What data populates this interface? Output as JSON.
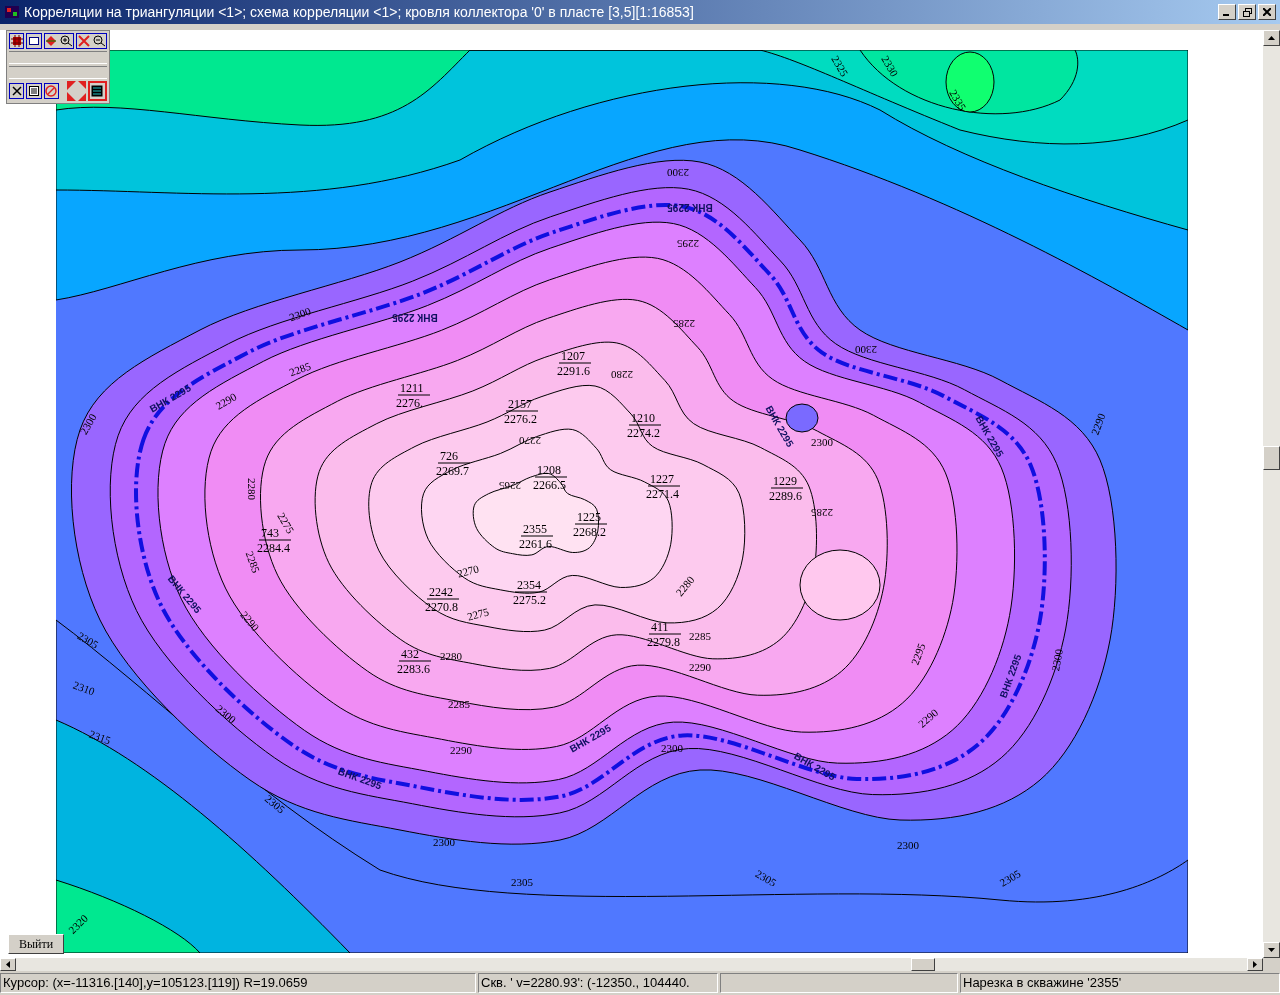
{
  "window": {
    "title": "Корреляции на триангуляции <1>; схема корреляции <1>; кровля коллектора '0' в пласте [3,5][1:16853]"
  },
  "exit_button": {
    "label": "Выйти"
  },
  "map": {
    "wells": [
      {
        "number": "1207",
        "value": "2291.6"
      },
      {
        "number": "1211",
        "value": "2276."
      },
      {
        "number": "2157",
        "value": "2276.2"
      },
      {
        "number": "1210",
        "value": "2274.2"
      },
      {
        "number": "726",
        "value": "2269.7"
      },
      {
        "number": "1208",
        "value": "2266.5"
      },
      {
        "number": "1227",
        "value": "2271.4"
      },
      {
        "number": "1225",
        "value": "2268.2"
      },
      {
        "number": "2355",
        "value": "2261.6"
      },
      {
        "number": "2242",
        "value": "2270.8"
      },
      {
        "number": "2354",
        "value": "2275.2"
      },
      {
        "number": "411",
        "value": "2279.8"
      },
      {
        "number": "432",
        "value": "2283.6"
      },
      {
        "number": "743",
        "value": "2284.4"
      },
      {
        "number": "1229",
        "value": "2289.6"
      }
    ],
    "contour_labels": [
      "2300",
      "2295",
      "2285",
      "2280",
      "2270",
      "2265",
      "2270",
      "2275",
      "2280",
      "2285",
      "2290",
      "2300",
      "2300",
      "2305",
      "2300",
      "2305",
      "2305",
      "2290",
      "2285",
      "2280",
      "2285",
      "2300",
      "2290",
      "2300",
      "2290",
      "2295",
      "2300",
      "2305",
      "2310",
      "2315",
      "2305",
      "2320",
      "2300",
      "2290",
      "2285",
      "2280",
      "2275",
      "2290",
      "2285",
      "2300",
      "2325",
      "2330",
      "2335",
      "2300"
    ],
    "owc_labels": [
      "ВНК 2295",
      "ВНК 2295",
      "ВНК 2295",
      "ВНК 2295",
      "ВНК 2295",
      "ВНК 2295",
      "ВНК 2295",
      "ВНК 2295",
      "ВНК 2295",
      "ВНК 2295"
    ]
  },
  "status_bar": {
    "cursor": "Курсор: (x=-11316.[140],y=105123.[119]) R=19.0659",
    "well": "Скв. ' v=2280.93': (-12350., 104440.",
    "message": "Нарезка в скважине '2355'"
  }
}
